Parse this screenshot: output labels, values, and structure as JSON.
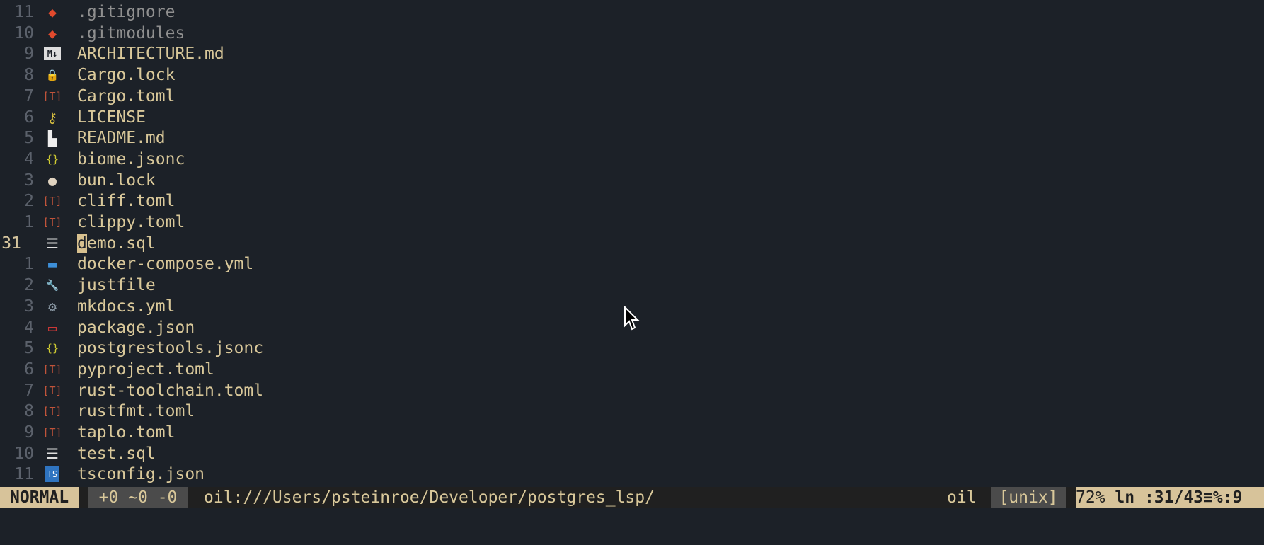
{
  "files": [
    {
      "num": "11",
      "name": ".gitignore",
      "icon": "git-icon",
      "glyph": "◆",
      "color": "#e24a2d",
      "hidden": true
    },
    {
      "num": "10",
      "name": ".gitmodules",
      "icon": "git-icon",
      "glyph": "◆",
      "color": "#e24a2d",
      "hidden": true
    },
    {
      "num": "9",
      "name": "ARCHITECTURE.md",
      "icon": "markdown-icon",
      "glyph": "M↓",
      "color": "#dddddd"
    },
    {
      "num": "8",
      "name": "Cargo.lock",
      "icon": "lock-icon",
      "glyph": "🔒",
      "color": "#bbbbbb"
    },
    {
      "num": "7",
      "name": "Cargo.toml",
      "icon": "toml-icon",
      "glyph": "[T]",
      "color": "#c0533a"
    },
    {
      "num": "6",
      "name": "LICENSE",
      "icon": "license-icon",
      "glyph": "⚷",
      "color": "#d8c040"
    },
    {
      "num": "5",
      "name": "README.md",
      "icon": "readme-icon",
      "glyph": "▙",
      "color": "#eeeeee"
    },
    {
      "num": "4",
      "name": "biome.jsonc",
      "icon": "json-icon",
      "glyph": "{}",
      "color": "#cfcb32"
    },
    {
      "num": "3",
      "name": "bun.lock",
      "icon": "bun-icon",
      "glyph": "●",
      "color": "#e0d3c0"
    },
    {
      "num": "2",
      "name": "cliff.toml",
      "icon": "toml-icon",
      "glyph": "[T]",
      "color": "#c0533a"
    },
    {
      "num": "1",
      "name": "clippy.toml",
      "icon": "toml-icon",
      "glyph": "[T]",
      "color": "#c0533a"
    },
    {
      "num": "31",
      "name": "demo.sql",
      "icon": "database-icon",
      "glyph": "☰",
      "color": "#dddddd",
      "current": true
    },
    {
      "num": "1",
      "name": "docker-compose.yml",
      "icon": "docker-icon",
      "glyph": "▬",
      "color": "#3d8fd8"
    },
    {
      "num": "2",
      "name": "justfile",
      "icon": "wrench-icon",
      "glyph": "🔧",
      "color": "#6d8086"
    },
    {
      "num": "3",
      "name": "mkdocs.yml",
      "icon": "gear-icon",
      "glyph": "⚙",
      "color": "#8a98a4"
    },
    {
      "num": "4",
      "name": "package.json",
      "icon": "npm-icon",
      "glyph": "▭",
      "color": "#cb3837"
    },
    {
      "num": "5",
      "name": "postgrestools.jsonc",
      "icon": "json-icon",
      "glyph": "{}",
      "color": "#cfcb32"
    },
    {
      "num": "6",
      "name": "pyproject.toml",
      "icon": "toml-icon",
      "glyph": "[T]",
      "color": "#c0533a"
    },
    {
      "num": "7",
      "name": "rust-toolchain.toml",
      "icon": "toml-icon",
      "glyph": "[T]",
      "color": "#c0533a"
    },
    {
      "num": "8",
      "name": "rustfmt.toml",
      "icon": "toml-icon",
      "glyph": "[T]",
      "color": "#c0533a"
    },
    {
      "num": "9",
      "name": "taplo.toml",
      "icon": "toml-icon",
      "glyph": "[T]",
      "color": "#c0533a"
    },
    {
      "num": "10",
      "name": "test.sql",
      "icon": "database-icon",
      "glyph": "☰",
      "color": "#dddddd"
    },
    {
      "num": "11",
      "name": "tsconfig.json",
      "icon": "typescript-icon",
      "glyph": "TS",
      "color": "#519aba"
    }
  ],
  "statusbar": {
    "mode": "NORMAL",
    "diff": "+0 ~0 -0",
    "path": "oil:///Users/psteinroe/Developer/postgres_lsp/",
    "filetype": "oil",
    "format": "[unix]",
    "percent": "72%",
    "position": "ln :31/43≡%:9"
  },
  "colors": {
    "background": "#1c2128",
    "accent": "#d7c39a",
    "text": "#d9c89a"
  }
}
